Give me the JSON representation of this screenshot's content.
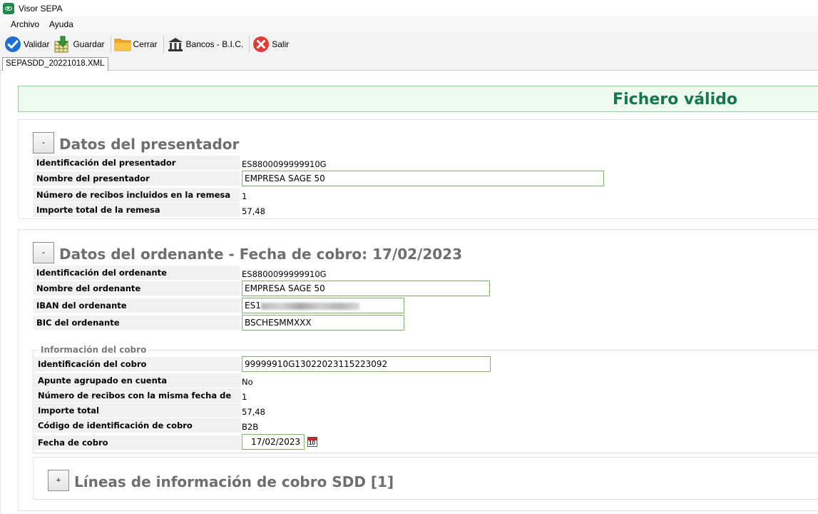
{
  "window": {
    "title": "Visor SEPA"
  },
  "menu": {
    "items": [
      "Archivo",
      "Ayuda"
    ]
  },
  "toolbar": {
    "validar": "Validar",
    "guardar": "Guardar",
    "cerrar": "Cerrar",
    "bancos": "Bancos - B.I.C.",
    "salir": "Salir"
  },
  "tab": {
    "label": "SEPASDD_20221018.XML"
  },
  "status": {
    "text": "Fichero válido"
  },
  "presentador": {
    "toggle": "-",
    "title": "Datos del presentador",
    "id_label": "Identificación del presentador",
    "id_value": "ES8800099999910G",
    "nombre_label": "Nombre del presentador",
    "nombre_value": "EMPRESA SAGE 50",
    "num_label": "Número de recibos incluidos en la remesa",
    "num_value": "1",
    "importe_label": "Importe total de la remesa",
    "importe_value": "57,48"
  },
  "ordenante": {
    "toggle": "-",
    "title": "Datos del ordenante - Fecha de cobro: 17/02/2023",
    "id_label": "Identificación del ordenante",
    "id_value": "ES8800099999910G",
    "nombre_label": "Nombre del ordenante",
    "nombre_value": "EMPRESA SAGE 50",
    "iban_label": "IBAN del ordenante",
    "iban_prefix": "ES1",
    "bic_label": "BIC del ordenante",
    "bic_value": "BSCHESMMXXX"
  },
  "cobro": {
    "legend": "Información del cobro",
    "id_label": "Identificación del cobro",
    "id_value": "99999910G13022023115223092",
    "apunte_label": "Apunte agrupado en cuenta",
    "apunte_value": "No",
    "num_label": "Número de recibos con la misma fecha de cobro",
    "num_value": "1",
    "importe_label": "Importe total",
    "importe_value": "57,48",
    "codigo_label": "Código de identificación de cobro",
    "codigo_value": "B2B",
    "fecha_label": "Fecha de cobro",
    "fecha_value": "17/02/2023",
    "calendar_day": "10"
  },
  "lineas": {
    "toggle": "+",
    "title": "Líneas de información de cobro SDD [1]"
  },
  "icons": {
    "app": "eye-icon",
    "validar": "check-circle-icon",
    "guardar": "save-download-icon",
    "cerrar": "folder-icon",
    "bancos": "bank-icon",
    "salir": "close-circle-icon",
    "calendar": "calendar-icon"
  },
  "colors": {
    "valid_text": "#16784a",
    "valid_bg": "#edfaee",
    "field_border": "#7fb06c",
    "section_title": "#6e6e6e"
  }
}
